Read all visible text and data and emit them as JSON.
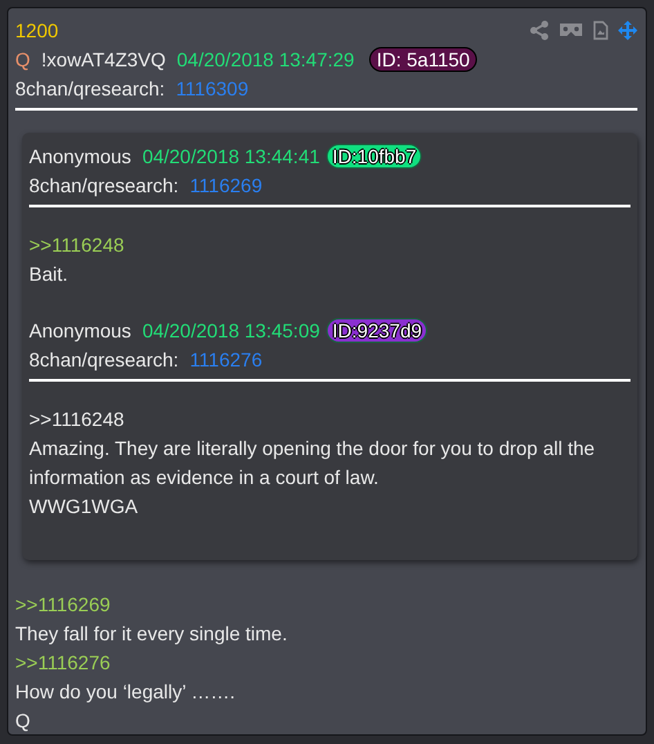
{
  "post": {
    "number": "1200",
    "tripcode_name": "Q",
    "tripcode": "!xowAT4Z3VQ",
    "timestamp": "04/20/2018 13:47:29",
    "id": "ID: 5a1150",
    "color": "#5a1048",
    "board": "8chan/qresearch:",
    "post_link": "1116309"
  },
  "quoted_posts": [
    {
      "author": "Anonymous",
      "timestamp": "04/20/2018 13:44:41",
      "id": "ID:10fbb7",
      "color": "#10e080",
      "board": "8chan/qresearch:",
      "post_link": "1116269",
      "lines": [
        {
          "kind": "reply-link",
          "text": ">>1116248"
        },
        {
          "kind": "text",
          "text": "Bait."
        }
      ]
    },
    {
      "author": "Anonymous",
      "timestamp": "04/20/2018 13:45:09",
      "id": "ID:9237d9",
      "color": "#8a30d0",
      "board": "8chan/qresearch:",
      "post_link": "1116276",
      "lines": [
        {
          "kind": "text",
          "text": ">>1116248"
        },
        {
          "kind": "text",
          "text": "Amazing. They are literally opening the door for you to drop all the information as evidence in a court of law."
        },
        {
          "kind": "text",
          "text": "WWG1WGA"
        }
      ]
    }
  ],
  "body": [
    {
      "kind": "reply-link",
      "text": ">>1116269"
    },
    {
      "kind": "text",
      "text": "They fall for it every single time."
    },
    {
      "kind": "reply-link",
      "text": ">>1116276"
    },
    {
      "kind": "text",
      "text": "How do you ‘legally’ ……."
    },
    {
      "kind": "text",
      "text": "Q"
    }
  ]
}
